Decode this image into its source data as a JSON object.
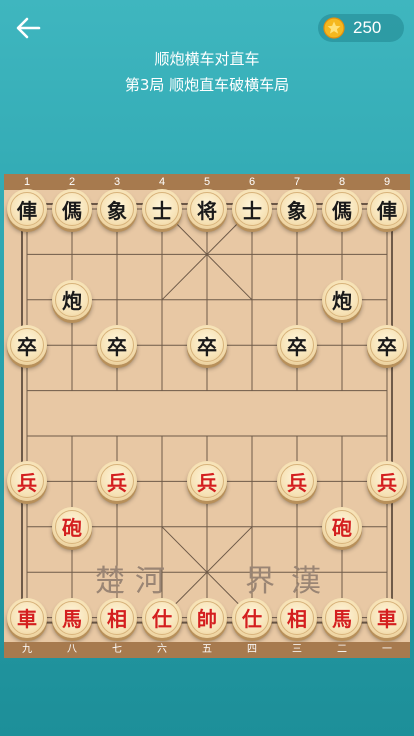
{
  "header": {
    "coins": "250",
    "title": "顺炮横车对直车",
    "subtitle": "第3局 顺炮直车破横车局"
  },
  "board": {
    "top_numbers": [
      "1",
      "2",
      "3",
      "4",
      "5",
      "6",
      "7",
      "8",
      "9"
    ],
    "bottom_numbers": [
      "九",
      "八",
      "七",
      "六",
      "五",
      "四",
      "三",
      "二",
      "一"
    ],
    "river_left": [
      "楚",
      "河"
    ],
    "river_right": [
      "界",
      "漢"
    ]
  },
  "pieces": [
    {
      "side": "black",
      "label": "俥",
      "col": 0,
      "row": 0
    },
    {
      "side": "black",
      "label": "傌",
      "col": 1,
      "row": 0
    },
    {
      "side": "black",
      "label": "象",
      "col": 2,
      "row": 0
    },
    {
      "side": "black",
      "label": "士",
      "col": 3,
      "row": 0
    },
    {
      "side": "black",
      "label": "将",
      "col": 4,
      "row": 0
    },
    {
      "side": "black",
      "label": "士",
      "col": 5,
      "row": 0
    },
    {
      "side": "black",
      "label": "象",
      "col": 6,
      "row": 0
    },
    {
      "side": "black",
      "label": "傌",
      "col": 7,
      "row": 0
    },
    {
      "side": "black",
      "label": "俥",
      "col": 8,
      "row": 0
    },
    {
      "side": "black",
      "label": "炮",
      "col": 1,
      "row": 2
    },
    {
      "side": "black",
      "label": "炮",
      "col": 7,
      "row": 2
    },
    {
      "side": "black",
      "label": "卒",
      "col": 0,
      "row": 3
    },
    {
      "side": "black",
      "label": "卒",
      "col": 2,
      "row": 3
    },
    {
      "side": "black",
      "label": "卒",
      "col": 4,
      "row": 3
    },
    {
      "side": "black",
      "label": "卒",
      "col": 6,
      "row": 3
    },
    {
      "side": "black",
      "label": "卒",
      "col": 8,
      "row": 3
    },
    {
      "side": "red",
      "label": "兵",
      "col": 0,
      "row": 6
    },
    {
      "side": "red",
      "label": "兵",
      "col": 2,
      "row": 6
    },
    {
      "side": "red",
      "label": "兵",
      "col": 4,
      "row": 6
    },
    {
      "side": "red",
      "label": "兵",
      "col": 6,
      "row": 6
    },
    {
      "side": "red",
      "label": "兵",
      "col": 8,
      "row": 6
    },
    {
      "side": "red",
      "label": "砲",
      "col": 1,
      "row": 7
    },
    {
      "side": "red",
      "label": "砲",
      "col": 7,
      "row": 7
    },
    {
      "side": "red",
      "label": "車",
      "col": 0,
      "row": 9
    },
    {
      "side": "red",
      "label": "馬",
      "col": 1,
      "row": 9
    },
    {
      "side": "red",
      "label": "相",
      "col": 2,
      "row": 9
    },
    {
      "side": "red",
      "label": "仕",
      "col": 3,
      "row": 9
    },
    {
      "side": "red",
      "label": "帥",
      "col": 4,
      "row": 9
    },
    {
      "side": "red",
      "label": "仕",
      "col": 5,
      "row": 9
    },
    {
      "side": "red",
      "label": "相",
      "col": 6,
      "row": 9
    },
    {
      "side": "red",
      "label": "馬",
      "col": 7,
      "row": 9
    },
    {
      "side": "red",
      "label": "車",
      "col": 8,
      "row": 9
    }
  ],
  "colors": {
    "background_top": "#3fb6bf",
    "board": "#e8c8a4",
    "strip": "#a77a4e",
    "red_piece": "#d41f1f",
    "black_piece": "#1a1a1a"
  }
}
